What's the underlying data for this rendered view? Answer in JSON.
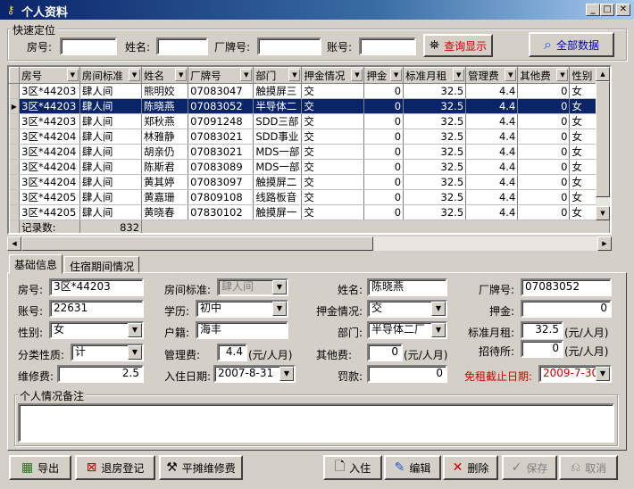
{
  "window": {
    "title": "个人资料"
  },
  "quick_search": {
    "title": "快速定位",
    "room_label": "房号:",
    "name_label": "姓名:",
    "badge_label": "厂牌号:",
    "account_label": "账号:",
    "query_button": "查询显示",
    "all_button": "全部数据"
  },
  "grid": {
    "columns": [
      "房号",
      "房间标准",
      "姓名",
      "厂牌号",
      "部门",
      "押金情况",
      "押金",
      "标准月租",
      "管理费",
      "其他费",
      "性别"
    ],
    "rows": [
      [
        "3区*44203",
        "肆人间",
        "熊明姣",
        "07083047",
        "触摸屏三",
        "交",
        "0",
        "32.5",
        "4.4",
        "0",
        "女"
      ],
      [
        "3区*44203",
        "肆人间",
        "陈晓燕",
        "07083052",
        "半导体二",
        "交",
        "0",
        "32.5",
        "4.4",
        "0",
        "女"
      ],
      [
        "3区*44203",
        "肆人间",
        "郑秋燕",
        "07091248",
        "SDD三部",
        "交",
        "0",
        "32.5",
        "4.4",
        "0",
        "女"
      ],
      [
        "3区*44204",
        "肆人间",
        "林雅静",
        "07083021",
        "SDD事业",
        "交",
        "0",
        "32.5",
        "4.4",
        "0",
        "女"
      ],
      [
        "3区*44204",
        "肆人间",
        "胡亲仍",
        "07083021",
        "MDS一部",
        "交",
        "0",
        "32.5",
        "4.4",
        "0",
        "女"
      ],
      [
        "3区*44204",
        "肆人间",
        "陈斯君",
        "07083089",
        "MDS一部",
        "交",
        "0",
        "32.5",
        "4.4",
        "0",
        "女"
      ],
      [
        "3区*44204",
        "肆人间",
        "黄其婷",
        "07083097",
        "触摸屏二",
        "交",
        "0",
        "32.5",
        "4.4",
        "0",
        "女"
      ],
      [
        "3区*44205",
        "肆人间",
        "黄嘉珊",
        "07809108",
        "线路板音",
        "交",
        "0",
        "32.5",
        "4.4",
        "0",
        "女"
      ],
      [
        "3区*44205",
        "肆人间",
        "黄晓春",
        "07830102",
        "触摸屏一",
        "交",
        "0",
        "32.5",
        "4.4",
        "0",
        "女"
      ]
    ],
    "selected_row": 1,
    "footer_label": "记录数:",
    "footer_count": "832"
  },
  "tabs": [
    "基础信息",
    "住宿期间情况"
  ],
  "form": {
    "room_label": "房号:",
    "room_value": "3区*44203",
    "standard_label": "房间标准:",
    "standard_value": "肆人间",
    "name_label": "姓名:",
    "name_value": "陈晓燕",
    "badge_label": "厂牌号:",
    "badge_value": "07083052",
    "account_label": "账号:",
    "account_value": "22631",
    "edu_label": "学历:",
    "edu_value": "初中",
    "deposit_status_label": "押金情况:",
    "deposit_status_value": "交",
    "deposit_label": "押金:",
    "deposit_value": "0",
    "gender_label": "性别:",
    "gender_value": "女",
    "hukou_label": "户籍:",
    "hukou_value": "海丰",
    "dept_label": "部门:",
    "dept_value": "半导体二厂",
    "rent_label": "标准月租:",
    "rent_value": "32.5",
    "rent_unit": "(元/人月)",
    "category_label": "分类性质:",
    "category_value": "计",
    "mgmt_label": "管理费:",
    "mgmt_value": "4.4",
    "mgmt_unit": "(元/人月)",
    "recruit_label": "招待所:",
    "recruit_value": "0",
    "recruit_unit": "(元/人月)",
    "other_label": "其他费:",
    "other_value": "0",
    "other_unit": "(元/人月)",
    "repair_label": "维修费:",
    "repair_value": "2.5",
    "checkin_label": "入住日期:",
    "checkin_value": "2007-8-31",
    "fine_label": "罚款:",
    "fine_value": "0",
    "rentfree_label": "免租截止日期:",
    "rentfree_value": "2009-7-30",
    "remarks_title": "个人情况备注"
  },
  "toolbar": {
    "export": "导出",
    "checkout": "退房登记",
    "repair_share": "平摊维修费",
    "checkin": "入住",
    "edit": "编辑",
    "delete": "删除",
    "save": "保存",
    "cancel": "取消"
  }
}
